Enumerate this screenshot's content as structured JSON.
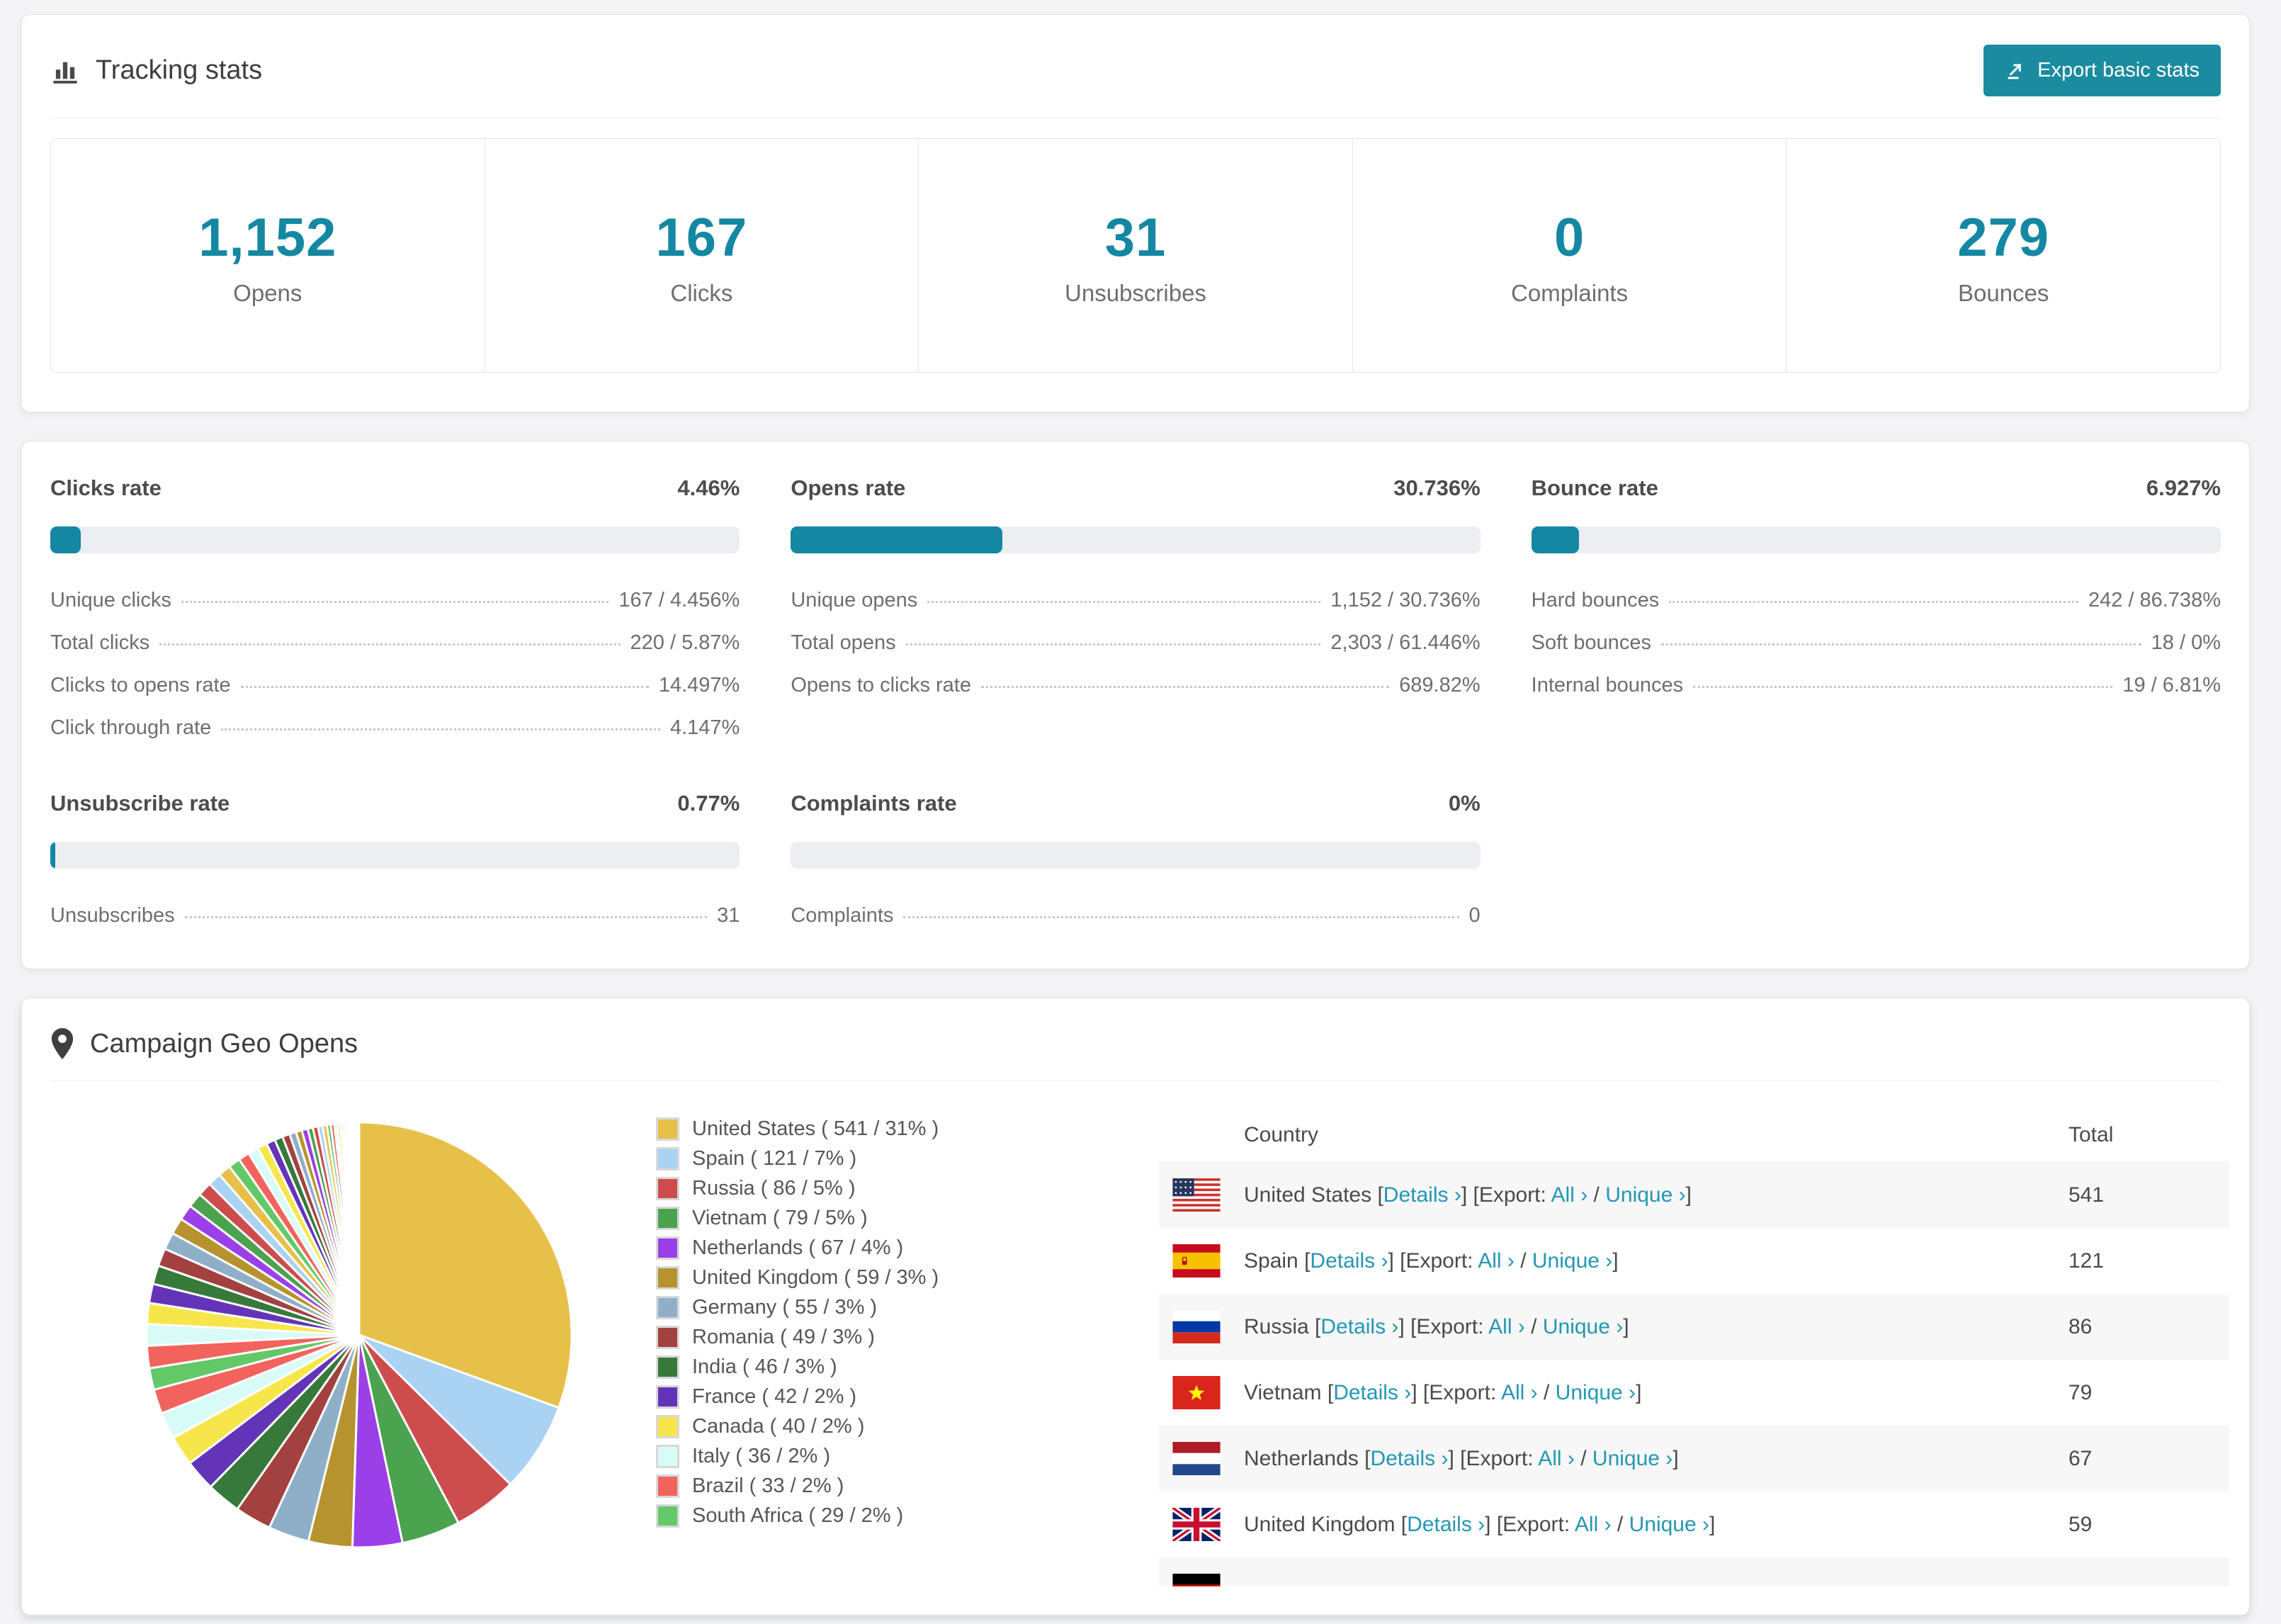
{
  "colors": {
    "accent_teal": "#1487a3",
    "button_teal": "#1b8ba0",
    "link_teal": "#2397b3",
    "bar_track": "#eceef1",
    "row_alt_bg": "#f7f7f7",
    "page_bg": "#f4f4f6"
  },
  "tracking": {
    "title": "Tracking stats",
    "export_button": "Export basic stats",
    "stats": [
      {
        "value": "1,152",
        "label": "Opens"
      },
      {
        "value": "167",
        "label": "Clicks"
      },
      {
        "value": "31",
        "label": "Unsubscribes"
      },
      {
        "value": "0",
        "label": "Complaints"
      },
      {
        "value": "279",
        "label": "Bounces"
      }
    ]
  },
  "rates": [
    {
      "title": "Clicks rate",
      "percent": "4.46%",
      "fill": 4.46,
      "rows": [
        {
          "label": "Unique clicks",
          "value": "167 / 4.456%"
        },
        {
          "label": "Total clicks",
          "value": "220 / 5.87%"
        },
        {
          "label": "Clicks to opens rate",
          "value": "14.497%"
        },
        {
          "label": "Click through rate",
          "value": "4.147%"
        }
      ]
    },
    {
      "title": "Opens rate",
      "percent": "30.736%",
      "fill": 30.736,
      "rows": [
        {
          "label": "Unique opens",
          "value": "1,152 / 30.736%"
        },
        {
          "label": "Total opens",
          "value": "2,303 / 61.446%"
        },
        {
          "label": "Opens to clicks rate",
          "value": "689.82%"
        }
      ]
    },
    {
      "title": "Bounce rate",
      "percent": "6.927%",
      "fill": 6.927,
      "rows": [
        {
          "label": "Hard bounces",
          "value": "242 / 86.738%"
        },
        {
          "label": "Soft bounces",
          "value": "18 / 0%"
        },
        {
          "label": "Internal bounces",
          "value": "19 / 6.81%"
        }
      ]
    },
    {
      "title": "Unsubscribe rate",
      "percent": "0.77%",
      "fill": 0.77,
      "rows": [
        {
          "label": "Unsubscribes",
          "value": "31"
        }
      ]
    },
    {
      "title": "Complaints rate",
      "percent": "0%",
      "fill": 0,
      "rows": [
        {
          "label": "Complaints",
          "value": "0"
        }
      ]
    }
  ],
  "geo": {
    "title": "Campaign Geo Opens",
    "legend": [
      {
        "label": "United States ( 541 / 31% )",
        "color": "#e7c04a"
      },
      {
        "label": "Spain ( 121 / 7% )",
        "color": "#a9d2f3"
      },
      {
        "label": "Russia ( 86 / 5% )",
        "color": "#cd4c4e"
      },
      {
        "label": "Vietnam ( 79 / 5% )",
        "color": "#4ba24f"
      },
      {
        "label": "Netherlands ( 67 / 4% )",
        "color": "#9b3fe8"
      },
      {
        "label": "United Kingdom ( 59 / 3% )",
        "color": "#b6932e"
      },
      {
        "label": "Germany ( 55 / 3% )",
        "color": "#8fafc9"
      },
      {
        "label": "Romania ( 49 / 3% )",
        "color": "#a34140"
      },
      {
        "label": "India ( 46 / 3% )",
        "color": "#36793a"
      },
      {
        "label": "France ( 42 / 2% )",
        "color": "#6434b8"
      },
      {
        "label": "Canada ( 40 / 2% )",
        "color": "#f6e64c"
      },
      {
        "label": "Italy ( 36 / 2% )",
        "color": "#d9fbf8"
      },
      {
        "label": "Brazil ( 33 / 2% )",
        "color": "#f2635e"
      },
      {
        "label": "South Africa ( 29 / 2% )",
        "color": "#63c868"
      }
    ],
    "table": {
      "headers": [
        "Country",
        "Total"
      ],
      "link_parts": {
        "open": "[",
        "details": "Details ›",
        "close": "]",
        "export": "[Export:",
        "all": "All ›",
        "slash": "/",
        "unique": "Unique ›"
      },
      "rows": [
        {
          "country": "United States",
          "flag": "us",
          "total": "541"
        },
        {
          "country": "Spain",
          "flag": "es",
          "total": "121"
        },
        {
          "country": "Russia",
          "flag": "ru",
          "total": "86"
        },
        {
          "country": "Vietnam",
          "flag": "vn",
          "total": "79"
        },
        {
          "country": "Netherlands",
          "flag": "nl",
          "total": "67"
        },
        {
          "country": "United Kingdom",
          "flag": "gb",
          "total": "59"
        }
      ],
      "partial_row": {
        "flag": "de",
        "country": "",
        "total": ""
      }
    }
  },
  "chart_data": {
    "type": "pie",
    "title": "Campaign Geo Opens",
    "unit": "opens",
    "legend_position": "right",
    "series": [
      {
        "name": "United States",
        "value": 541,
        "percent": 31,
        "color": "#e7c04a"
      },
      {
        "name": "Spain",
        "value": 121,
        "percent": 7,
        "color": "#a9d2f3"
      },
      {
        "name": "Russia",
        "value": 86,
        "percent": 5,
        "color": "#cd4c4e"
      },
      {
        "name": "Vietnam",
        "value": 79,
        "percent": 5,
        "color": "#4ba24f"
      },
      {
        "name": "Netherlands",
        "value": 67,
        "percent": 4,
        "color": "#9b3fe8"
      },
      {
        "name": "United Kingdom",
        "value": 59,
        "percent": 3,
        "color": "#b6932e"
      },
      {
        "name": "Germany",
        "value": 55,
        "percent": 3,
        "color": "#8fafc9"
      },
      {
        "name": "Romania",
        "value": 49,
        "percent": 3,
        "color": "#a34140"
      },
      {
        "name": "India",
        "value": 46,
        "percent": 3,
        "color": "#36793a"
      },
      {
        "name": "France",
        "value": 42,
        "percent": 2,
        "color": "#6434b8"
      },
      {
        "name": "Canada",
        "value": 40,
        "percent": 2,
        "color": "#f6e64c"
      },
      {
        "name": "Italy",
        "value": 36,
        "percent": 2,
        "color": "#d9fbf8"
      },
      {
        "name": "Brazil",
        "value": 33,
        "percent": 2,
        "color": "#f2635e"
      },
      {
        "name": "South Africa",
        "value": 29,
        "percent": 2,
        "color": "#63c868"
      }
    ],
    "tail_values_estimated": [
      30,
      29,
      28,
      26,
      25,
      24,
      23,
      22,
      21,
      20,
      19,
      18,
      17,
      16,
      15,
      14,
      13,
      12,
      11,
      10,
      9,
      8,
      8,
      7,
      7,
      6,
      6,
      5,
      5,
      4,
      4,
      3,
      3,
      3,
      2,
      2,
      2,
      2,
      1,
      1,
      1,
      1,
      1,
      1,
      1,
      1
    ]
  }
}
